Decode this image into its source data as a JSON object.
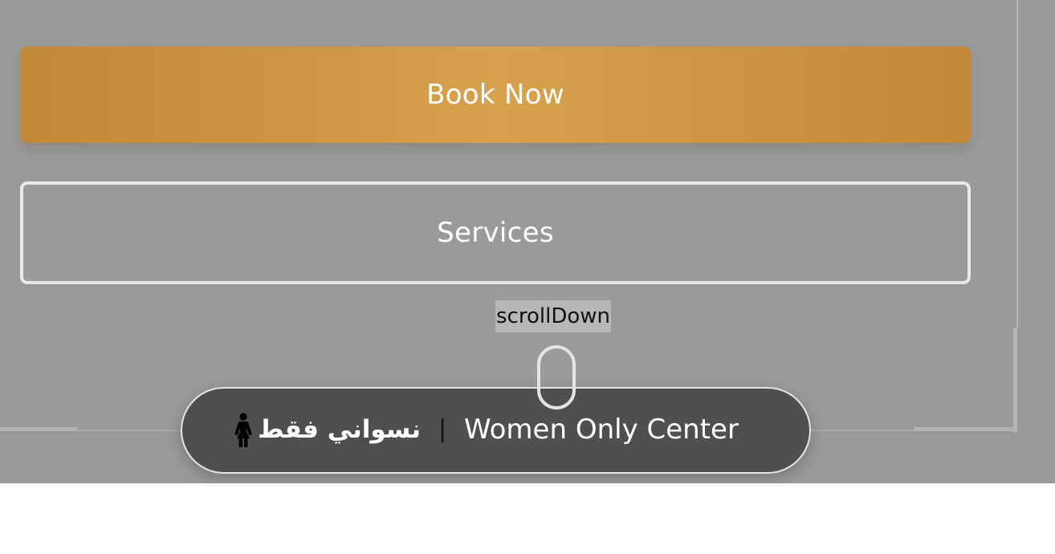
{
  "buttons": {
    "book_now_label": "Book Now",
    "services_label": "Services"
  },
  "scroll": {
    "label": "scrollDown",
    "icon": "mouse-scroll-icon"
  },
  "badge": {
    "arabic_label": "نسواني فقط",
    "divider": "|",
    "english_label": "Women Only Center",
    "icon": "woman-icon"
  },
  "colors": {
    "overlay_gray": "#9a9a9a",
    "book_now_gold": "#d8a14d",
    "badge_dark": "#4f4f4f",
    "button_text": "#ffffff"
  }
}
